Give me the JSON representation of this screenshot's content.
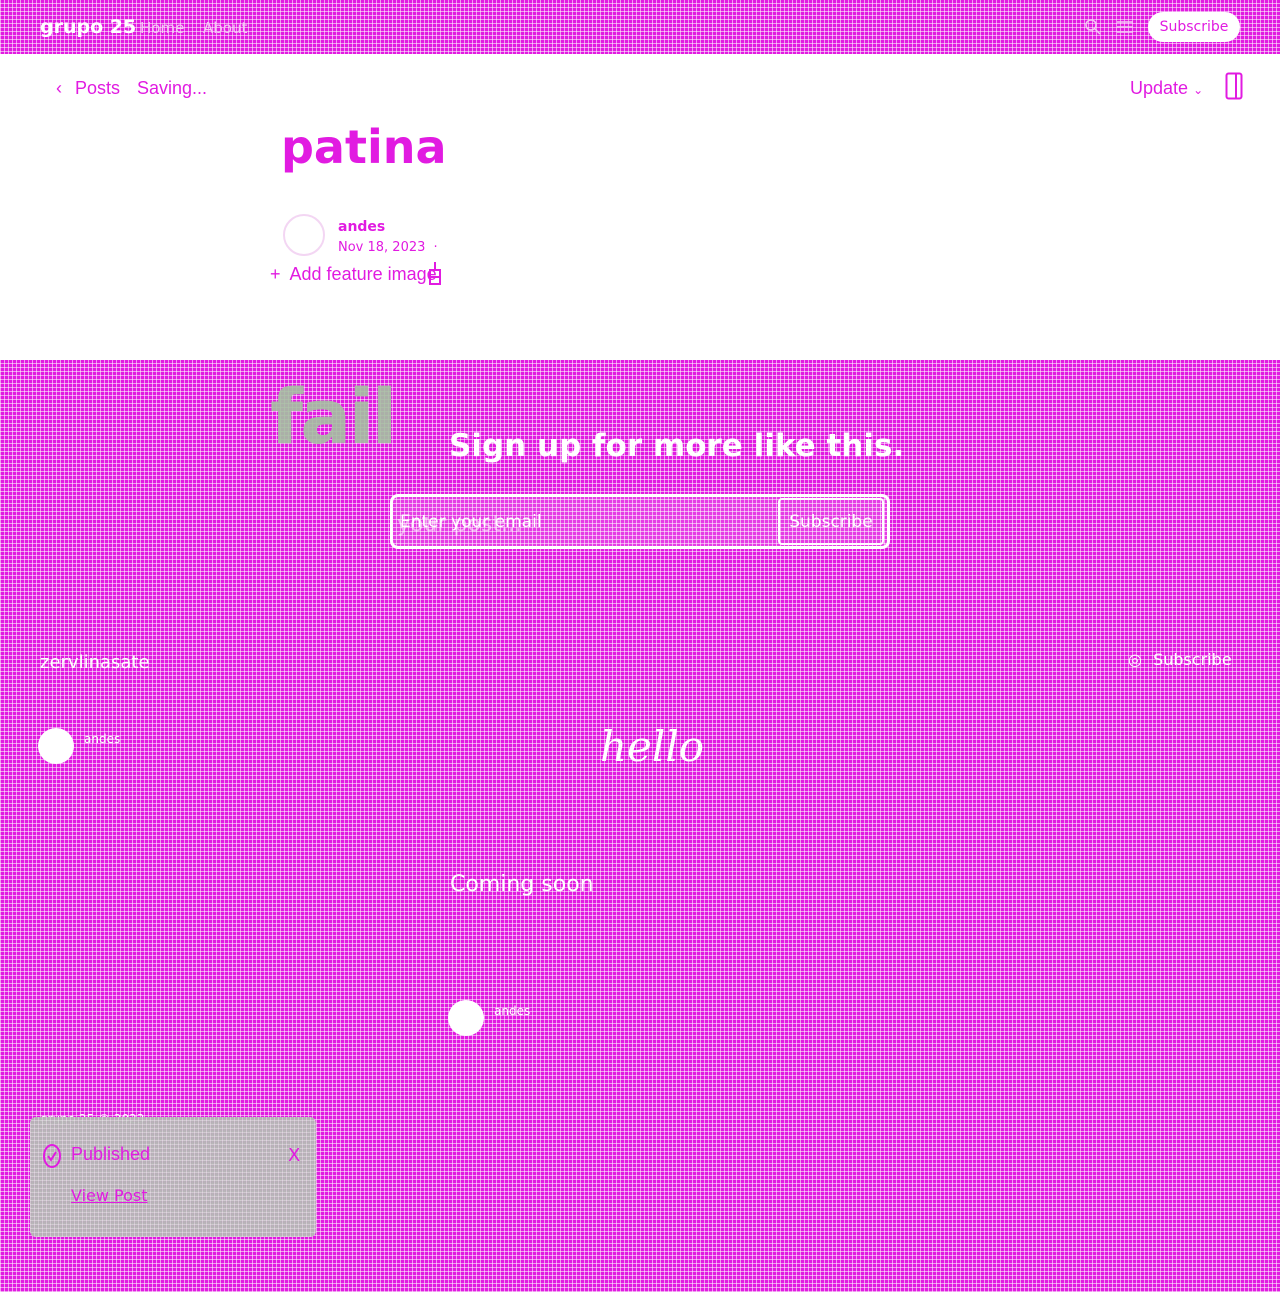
{
  "topnav": {
    "brand": "grupo 25",
    "links": [
      "Home",
      "About"
    ],
    "subscribe_label": "Subscribe"
  },
  "editor": {
    "back_label": "Posts",
    "status": "Saving...",
    "update_label": "Update",
    "title": "patina",
    "author": "andes",
    "date": "Nov 18, 2023",
    "add_feature_image": "Add feature image"
  },
  "content": {
    "fail_text": "fail",
    "signup_heading": "Sign up for more like this.",
    "email_placeholder": "Enter your email",
    "ghost_text": "your post...",
    "email_subscribe": "Subscribe"
  },
  "section": {
    "name": "zervlinasate",
    "subscribe_label": "Subscribe",
    "author": "andes",
    "hello": "hello",
    "coming_soon": "Coming soon",
    "author2": "andes"
  },
  "footer": {
    "text": "grupo 25 © 2023"
  },
  "toast": {
    "title": "Published",
    "close": "X",
    "link": "View Post"
  },
  "colors": {
    "accent": "#e11be1",
    "text_light": "#ffffff",
    "toast_bg": "#b6b6b6",
    "fail_text": "#a6c0a2"
  },
  "icons": [
    "search-icon",
    "menu-icon",
    "chevron-left-icon",
    "chevron-down-icon",
    "sidebar-toggle-icon",
    "plus-icon",
    "settings-icon",
    "check-circle-icon",
    "at-icon"
  ]
}
